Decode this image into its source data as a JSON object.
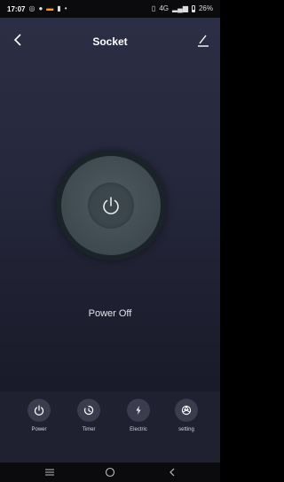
{
  "status_bar": {
    "time": "17:07",
    "signal": "4G",
    "battery": "26%"
  },
  "header": {
    "title": "Socket"
  },
  "device": {
    "power_status": "Power Off"
  },
  "actions": [
    {
      "label": "Power",
      "icon": "power-icon"
    },
    {
      "label": "Timer",
      "icon": "timer-icon"
    },
    {
      "label": "Electric",
      "icon": "electric-icon"
    },
    {
      "label": "setting",
      "icon": "settings-icon"
    }
  ],
  "colors": {
    "background_top": "#2c2f45",
    "background_bottom": "#161724",
    "dial": "#414d53",
    "action_circle": "#3b3d4e"
  }
}
